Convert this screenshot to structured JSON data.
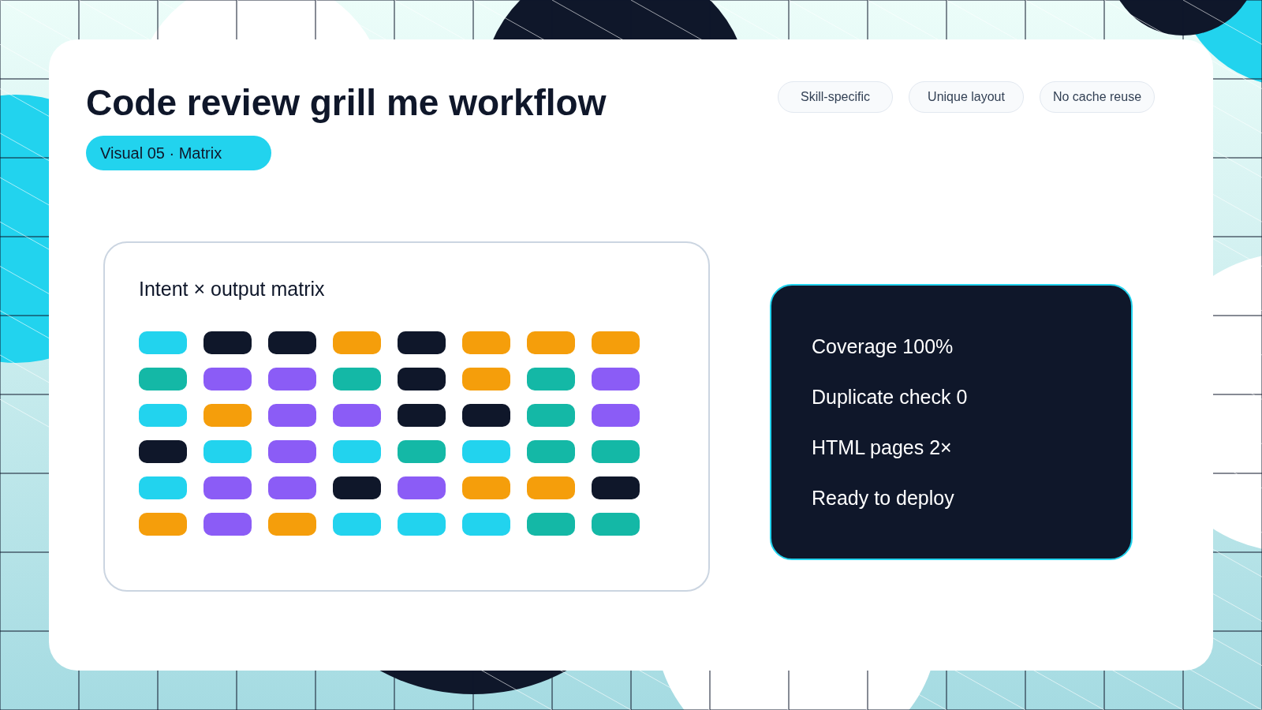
{
  "title": "Code review grill me workflow",
  "badge": "Visual 05 · Matrix",
  "tags": [
    "Skill-specific",
    "Unique layout",
    "No cache reuse"
  ],
  "matrix": {
    "title": "Intent × output matrix",
    "rows": [
      [
        {
          "color": "#22d3ee"
        },
        {
          "color": "#0f172a"
        },
        {
          "color": "#0f172a"
        },
        {
          "color": "#f59e0b"
        },
        {
          "color": "#0f172a"
        },
        {
          "color": "#f59e0b"
        },
        {
          "color": "#f59e0b"
        },
        {
          "color": "#f59e0b"
        }
      ],
      [
        {
          "color": "#14b8a6"
        },
        {
          "color": "#8b5cf6"
        },
        {
          "color": "#8b5cf6"
        },
        {
          "color": "#14b8a6"
        },
        {
          "color": "#0f172a"
        },
        {
          "color": "#f59e0b"
        },
        {
          "color": "#14b8a6"
        },
        {
          "color": "#8b5cf6"
        }
      ],
      [
        {
          "color": "#22d3ee"
        },
        {
          "color": "#f59e0b"
        },
        {
          "color": "#8b5cf6"
        },
        {
          "color": "#8b5cf6"
        },
        {
          "color": "#0f172a"
        },
        {
          "color": "#0f172a"
        },
        {
          "color": "#14b8a6"
        },
        {
          "color": "#8b5cf6"
        }
      ],
      [
        {
          "color": "#0f172a"
        },
        {
          "color": "#22d3ee"
        },
        {
          "color": "#8b5cf6"
        },
        {
          "color": "#22d3ee"
        },
        {
          "color": "#14b8a6"
        },
        {
          "color": "#22d3ee"
        },
        {
          "color": "#14b8a6"
        },
        {
          "color": "#14b8a6"
        }
      ],
      [
        {
          "color": "#22d3ee"
        },
        {
          "color": "#8b5cf6"
        },
        {
          "color": "#8b5cf6"
        },
        {
          "color": "#0f172a"
        },
        {
          "color": "#8b5cf6"
        },
        {
          "color": "#f59e0b"
        },
        {
          "color": "#f59e0b"
        },
        {
          "color": "#0f172a"
        }
      ],
      [
        {
          "color": "#f59e0b"
        },
        {
          "color": "#8b5cf6"
        },
        {
          "color": "#f59e0b"
        },
        {
          "color": "#22d3ee"
        },
        {
          "color": "#22d3ee"
        },
        {
          "color": "#22d3ee"
        },
        {
          "color": "#14b8a6"
        },
        {
          "color": "#14b8a6"
        }
      ]
    ]
  },
  "stats": [
    "Coverage 100%",
    "Duplicate check 0",
    "HTML pages 2×",
    "Ready to deploy"
  ]
}
